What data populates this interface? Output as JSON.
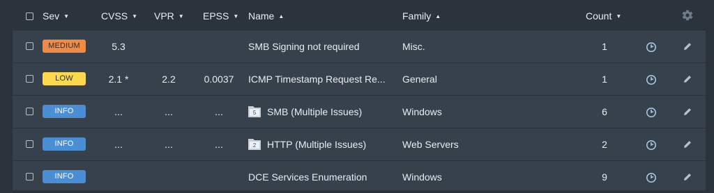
{
  "columns": {
    "sev": "Sev",
    "cvss": "CVSS",
    "vpr": "VPR",
    "epss": "EPSS",
    "name": "Name",
    "family": "Family",
    "count": "Count"
  },
  "sort_indicators": {
    "sev": "▼",
    "cvss": "▼",
    "vpr": "▼",
    "epss": "▼",
    "name": "▲",
    "family": "▲",
    "count": "▼"
  },
  "rows": [
    {
      "severity": "MEDIUM",
      "cvss": "5.3",
      "vpr": "",
      "epss": "",
      "name": "SMB Signing not required",
      "folder_count": "",
      "family": "Misc.",
      "count": "1"
    },
    {
      "severity": "LOW",
      "cvss": "2.1 *",
      "vpr": "2.2",
      "epss": "0.0037",
      "name": "ICMP Timestamp Request Re...",
      "folder_count": "",
      "family": "General",
      "count": "1"
    },
    {
      "severity": "INFO",
      "cvss": "...",
      "vpr": "...",
      "epss": "...",
      "name": "SMB (Multiple Issues)",
      "folder_count": "5",
      "family": "Windows",
      "count": "6"
    },
    {
      "severity": "INFO",
      "cvss": "...",
      "vpr": "...",
      "epss": "...",
      "name": "HTTP (Multiple Issues)",
      "folder_count": "2",
      "family": "Web Servers",
      "count": "2"
    },
    {
      "severity": "INFO",
      "cvss": "",
      "vpr": "",
      "epss": "",
      "name": "DCE Services Enumeration",
      "folder_count": "",
      "family": "Windows",
      "count": "9"
    }
  ],
  "icons": {
    "settings": "gear-icon",
    "snooze": "clock-icon",
    "edit": "pencil-icon",
    "group": "folder-icon"
  },
  "colors": {
    "medium": "#f08a44",
    "low": "#fbd84d",
    "info": "#4a8fd4"
  }
}
